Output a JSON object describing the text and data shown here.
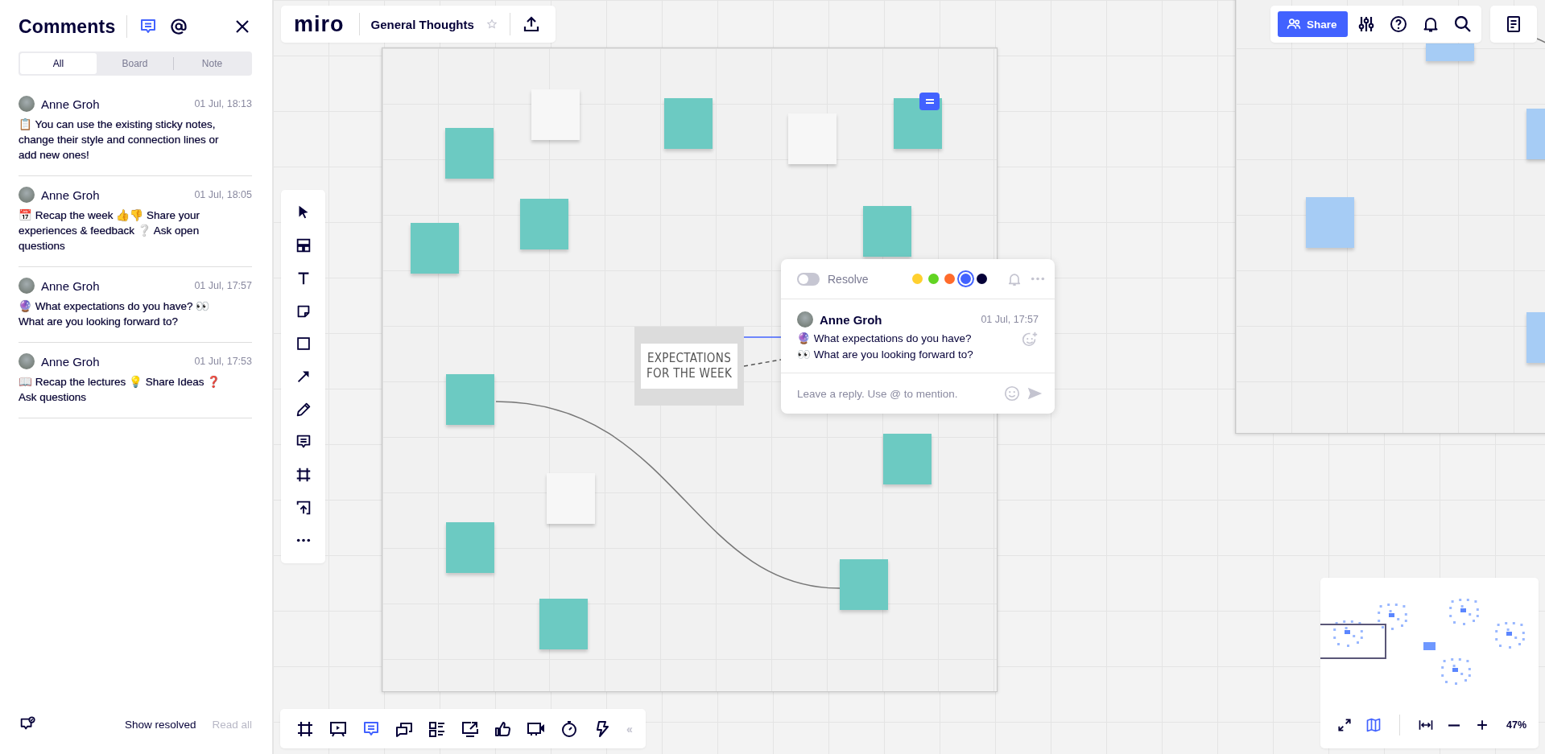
{
  "comments_panel": {
    "title": "Comments",
    "filters": [
      {
        "kind": "comments",
        "selected": true
      },
      {
        "kind": "mentions",
        "selected": false
      }
    ],
    "tabs": [
      {
        "label": "All",
        "selected": true
      },
      {
        "label": "Board",
        "selected": false
      },
      {
        "label": "Note",
        "selected": false
      }
    ],
    "comments": [
      {
        "author": "Anne Groh",
        "time": "01 Jul, 18:13",
        "text": "📋 You can use the existing sticky notes, change their style and connection lines or add new ones!"
      },
      {
        "author": "Anne Groh",
        "time": "01 Jul, 18:05",
        "text": "📅 Recap the week 👍👎 Share your experiences & feedback ❔ Ask open questions"
      },
      {
        "author": "Anne Groh",
        "time": "01 Jul, 17:57",
        "text": "🔮 What expectations do you have? 👀 What are you looking forward to?"
      },
      {
        "author": "Anne Groh",
        "time": "01 Jul, 17:53",
        "text": "📖 Recap the lectures 💡 Share Ideas ❓ Ask questions"
      }
    ],
    "show_resolved": "Show resolved",
    "read_all": {
      "label": "Read all",
      "disabled": true
    }
  },
  "top_bar": {
    "logo": "miro",
    "board_title": "General Thoughts",
    "share": "Share"
  },
  "board": {
    "image_text": [
      "EXPECTATIONS",
      "FOR THE WEEK"
    ],
    "sticky_notes": [
      {
        "color": "#6ccac2"
      },
      {
        "color": "#6ccac2"
      },
      {
        "color": "#6ccac2"
      },
      {
        "color": "#6ccac2"
      },
      {
        "color": "#6ccac2"
      },
      {
        "color": "#6ccac2"
      },
      {
        "color": "#6ccac2"
      },
      {
        "color": "#6ccac2"
      },
      {
        "color": "#6ccac2"
      },
      {
        "color": "#6ccac2"
      },
      {
        "color": "#6ccac2"
      },
      {
        "color": "#f7f7f7"
      },
      {
        "color": "#f7f7f7"
      },
      {
        "color": "#f7f7f7"
      },
      {
        "color": "#a6ccf5"
      },
      {
        "color": "#a6ccf5"
      },
      {
        "color": "#a6ccf5"
      },
      {
        "color": "#a6ccf5"
      }
    ]
  },
  "comment_popup": {
    "resolved": false,
    "resolve_label": "Resolve",
    "colors": [
      {
        "color": "#ffd02f",
        "selected": false
      },
      {
        "color": "#62d422",
        "selected": false
      },
      {
        "color": "#ff6b2b",
        "selected": false
      },
      {
        "color": "#4262ff",
        "selected": true
      },
      {
        "color": "#050038",
        "selected": false
      }
    ],
    "author": "Anne Groh",
    "time": "01 Jul, 17:57",
    "lines": [
      "🔮 What expectations do you have?",
      "👀 What are you looking forward to?"
    ],
    "reply": {
      "placeholder": "Leave a reply. Use @ to mention."
    }
  },
  "bottom_toolbar": [
    {
      "kind": "frames",
      "selected": false
    },
    {
      "kind": "present",
      "selected": false
    },
    {
      "kind": "comments",
      "selected": true
    },
    {
      "kind": "chat",
      "selected": false
    },
    {
      "kind": "cards",
      "selected": false
    },
    {
      "kind": "share-screen",
      "selected": false
    },
    {
      "kind": "vote",
      "selected": false
    },
    {
      "kind": "video",
      "selected": false
    },
    {
      "kind": "timer",
      "selected": false
    },
    {
      "kind": "lightning",
      "selected": false
    }
  ],
  "collapse": "‹‹",
  "minimap": {
    "zoom": "47%"
  }
}
